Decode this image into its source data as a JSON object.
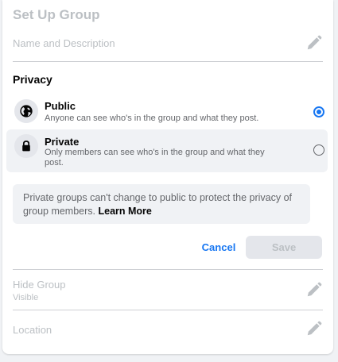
{
  "header": {
    "title": "Set Up Group"
  },
  "name_field": {
    "label": "Name and Description"
  },
  "privacy": {
    "section_title": "Privacy",
    "options": [
      {
        "title": "Public",
        "description": "Anyone can see who's in the group and what they post.",
        "selected": true
      },
      {
        "title": "Private",
        "description": "Only members can see who's in the group and what they post.",
        "selected": false
      }
    ],
    "notice_text": "Private groups can't change to public to protect the privacy of group members.",
    "learn_more": "Learn More"
  },
  "actions": {
    "cancel_label": "Cancel",
    "save_label": "Save"
  },
  "hide_group": {
    "label": "Hide Group",
    "value": "Visible"
  },
  "location": {
    "label": "Location"
  },
  "colors": {
    "accent": "#1877f2",
    "muted": "#bcc0c4",
    "secondary_text": "#65676b",
    "surface": "#f0f2f5"
  },
  "icons": {
    "edit": "pencil-icon",
    "public": "globe-icon",
    "private": "lock-icon"
  }
}
